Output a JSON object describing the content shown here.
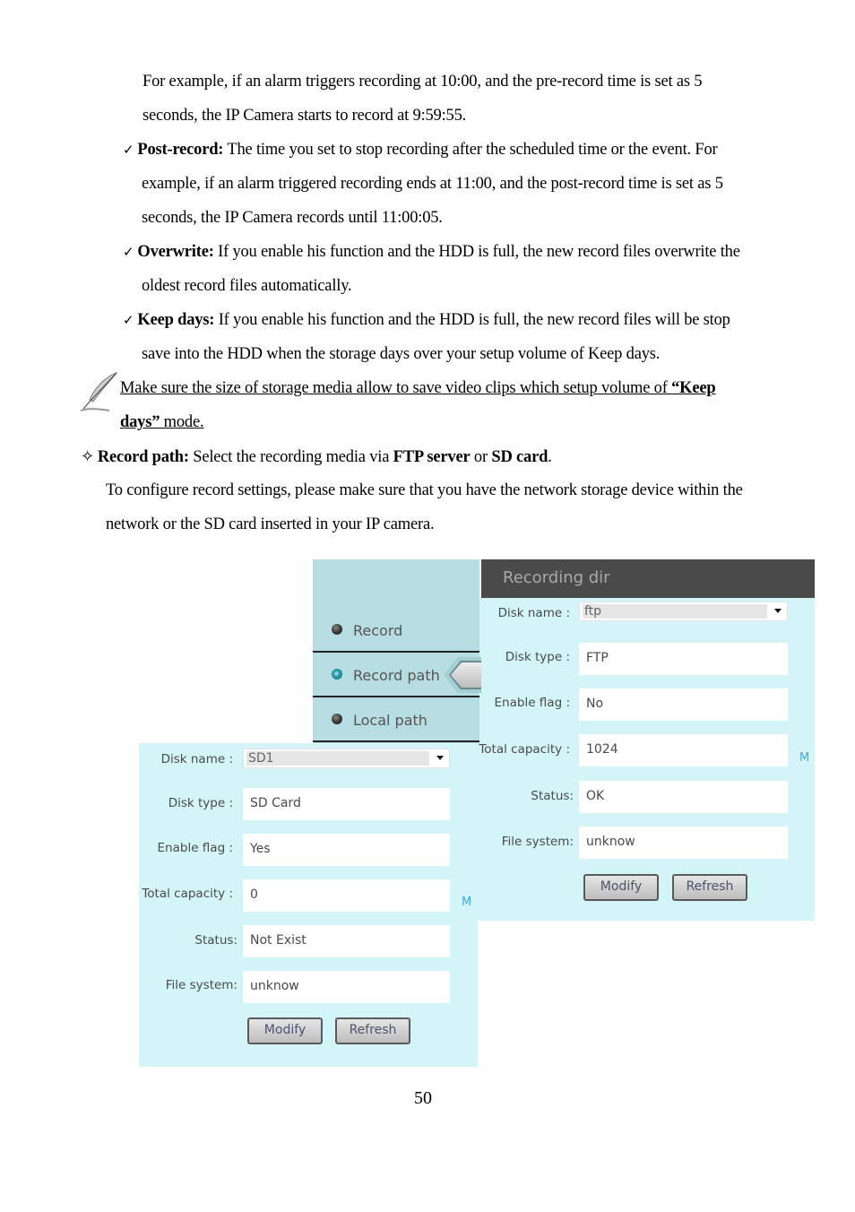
{
  "document": {
    "intro_lines": [
      "For example, if an alarm triggers recording at 10:00, and the pre-record time is set as 5",
      "seconds, the IP Camera starts to record at 9:59:55."
    ],
    "bullets": [
      {
        "term": "Post-record:",
        "lines": [
          " The time you set to stop recording after the scheduled time or the event. For",
          "example, if an alarm triggered recording ends at 11:00, and the post-record time is set as 5",
          "seconds, the IP Camera records until 11:00:05."
        ]
      },
      {
        "term": "Overwrite:",
        "lines": [
          " If you enable his function and the HDD is full, the new record files overwrite the",
          "oldest record files automatically."
        ]
      },
      {
        "term": "Keep days:",
        "lines": [
          " If you enable his function and the HDD is full, the new record files will be stop",
          "save into the HDD when the storage days over your setup volume of Keep days."
        ]
      }
    ],
    "check_glyph": "✓",
    "note": {
      "icon": "feather-note-icon",
      "line1_prefix": "Make sure the size of storage media allow to save video clips which setup volume of ",
      "line1_bold": "“Keep ",
      "line2_bold": "days”",
      "line2_suffix": " mode."
    },
    "record_path": {
      "glyph": "✧",
      "term": "Record path:",
      "text1": " Select the recording media via ",
      "ftp": "FTP server",
      "or": " or ",
      "sd": "SD card",
      "end": "."
    },
    "config_lines": [
      "To configure record settings, please make sure that you have the network storage device within the",
      "network or the SD card inserted in your IP camera."
    ],
    "page_number": "50"
  },
  "menu": {
    "items": [
      {
        "label": "Record",
        "active": false
      },
      {
        "label": "Record path",
        "active": true
      },
      {
        "label": "Local path",
        "active": false
      }
    ]
  },
  "ftp_form": {
    "title": "Recording dir",
    "disk_name_label": "Disk name :",
    "disk_name_value": "ftp",
    "disk_type_label": "Disk type :",
    "disk_type_value": "FTP",
    "enable_flag_label": "Enable flag :",
    "enable_flag_value": "No",
    "total_capacity_label": "Total capacity :",
    "total_capacity_value": "1024",
    "unit": "M",
    "status_label": "Status:",
    "status_value": "OK",
    "file_system_label": "File system:",
    "file_system_value": "unknow",
    "modify_label": "Modify",
    "refresh_label": "Refresh"
  },
  "sd_form": {
    "disk_name_label": "Disk name :",
    "disk_name_value": "SD1",
    "disk_type_label": "Disk type :",
    "disk_type_value": "SD Card",
    "enable_flag_label": "Enable flag :",
    "enable_flag_value": "Yes",
    "total_capacity_label": "Total capacity :",
    "total_capacity_value": "0",
    "unit": "M",
    "status_label": "Status:",
    "status_value": "Not Exist",
    "file_system_label": "File system:",
    "file_system_value": "unknow",
    "modify_label": "Modify",
    "refresh_label": "Refresh"
  }
}
